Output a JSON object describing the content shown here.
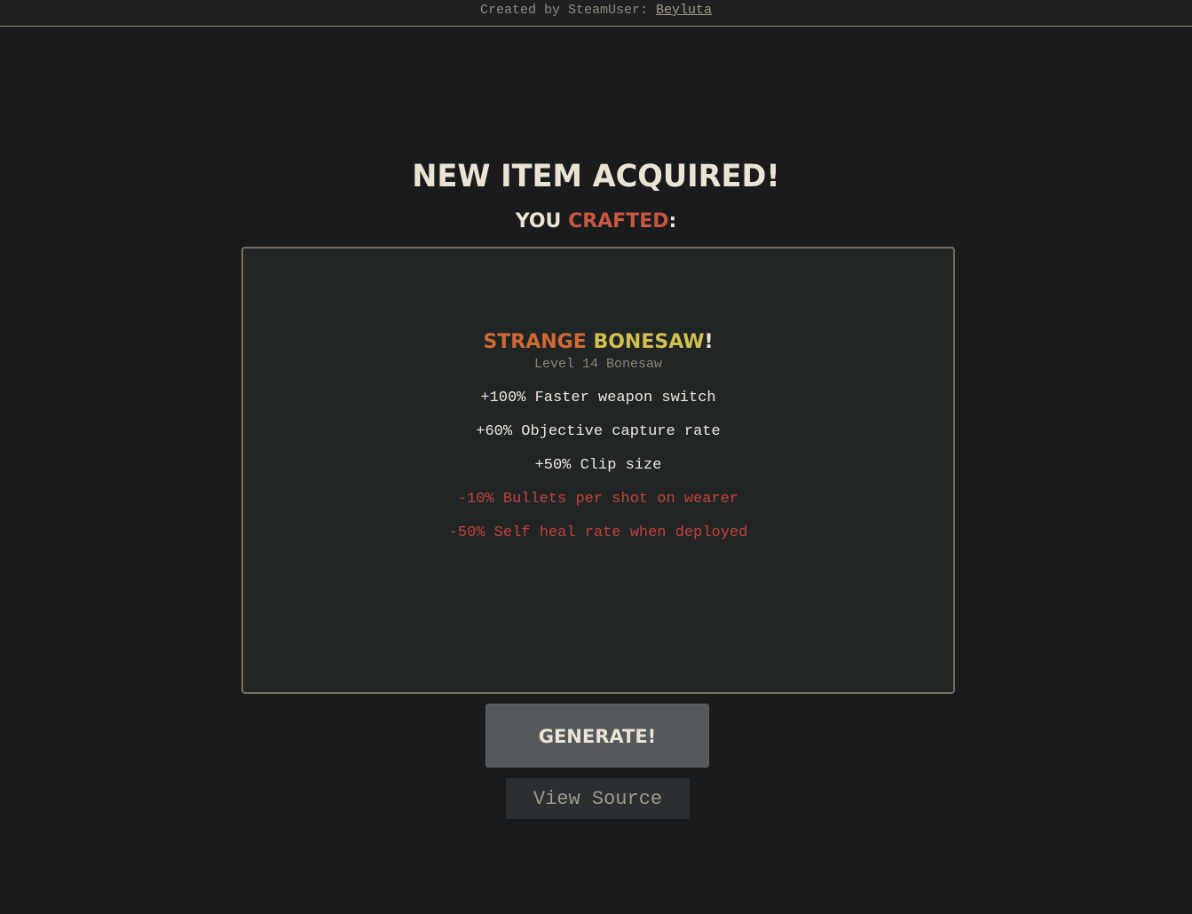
{
  "header": {
    "credit_prefix": "Created by SteamUser: ",
    "author": "Beyluta"
  },
  "banner": {
    "title": "New Item Acquired!",
    "subtitle_prefix": "You ",
    "subtitle_action": "Crafted",
    "subtitle_suffix": ":"
  },
  "item": {
    "quality": "Strange",
    "weapon": "Bonesaw",
    "exclaim": "!",
    "level_line": "Level 14 Bonesaw",
    "attributes": [
      {
        "text": "+100% Faster weapon switch",
        "type": "positive"
      },
      {
        "text": "+60% Objective capture rate",
        "type": "positive"
      },
      {
        "text": "+50% Clip size",
        "type": "positive"
      },
      {
        "text": "-10% Bullets per shot on wearer",
        "type": "negative"
      },
      {
        "text": "-50% Self heal rate when deployed",
        "type": "negative"
      }
    ]
  },
  "actions": {
    "generate_label": "Generate!",
    "source_label": "View Source"
  },
  "colors": {
    "background": "#1a1b1d",
    "card_bg": "#212526",
    "card_border": "#766f5c",
    "strange": "#cf6a32",
    "unique": "#cfc050",
    "crafted": "#c95643",
    "positive_attr": "#ede8de",
    "negative_attr": "#c2413a"
  }
}
